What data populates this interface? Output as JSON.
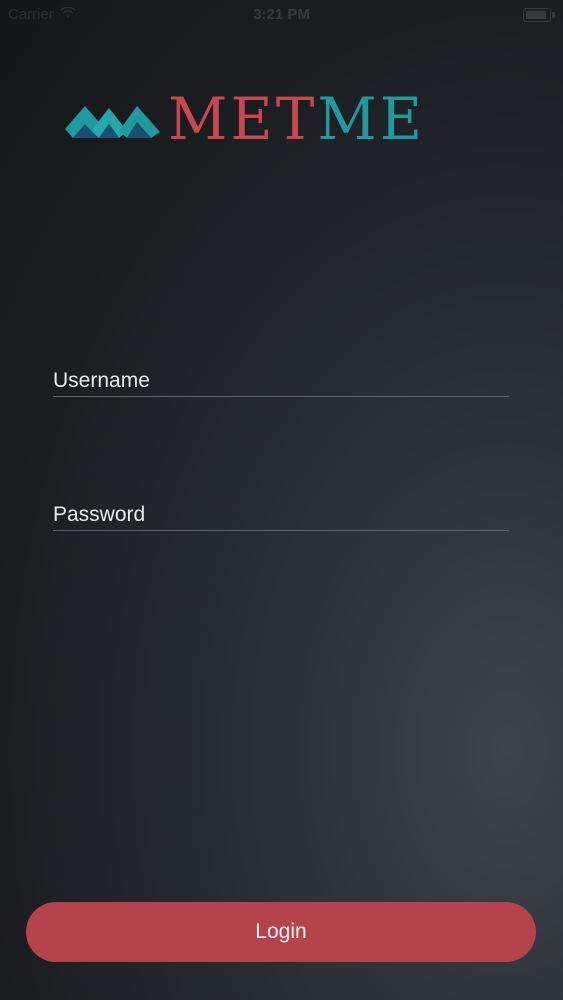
{
  "status_bar": {
    "carrier": "Carrier",
    "time": "3:21 PM",
    "battery_level": 0.9
  },
  "logo": {
    "text_part1": "MET",
    "text_part2": "ME",
    "colors": {
      "red": "#c9474e",
      "teal": "#1f9a9e"
    }
  },
  "form": {
    "username_placeholder": "Username",
    "username_value": "",
    "password_placeholder": "Password",
    "password_value": ""
  },
  "login_label": "Login",
  "colors": {
    "button": "#b5434b",
    "background": "#1b1e21"
  }
}
